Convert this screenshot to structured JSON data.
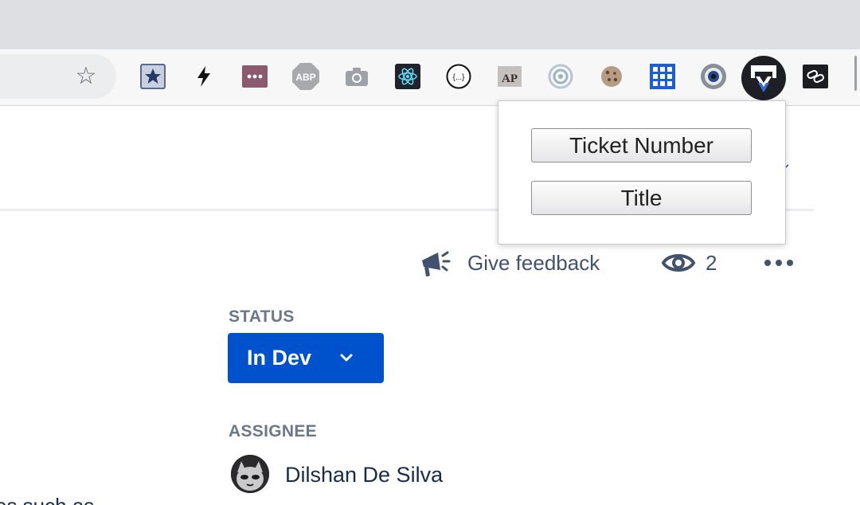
{
  "browser": {
    "extensions": [
      {
        "name": "star-bookmark-extension"
      },
      {
        "name": "lightning-extension"
      },
      {
        "name": "dots-extension"
      },
      {
        "name": "adblock-plus-extension",
        "text": "ABP"
      },
      {
        "name": "camera-extension"
      },
      {
        "name": "react-devtools-extension"
      },
      {
        "name": "json-formatter-extension",
        "text": "{...}"
      },
      {
        "name": "ap-extension",
        "text": "AP"
      },
      {
        "name": "target-extension"
      },
      {
        "name": "cookie-extension"
      },
      {
        "name": "grid-extension"
      },
      {
        "name": "eye-extension"
      },
      {
        "name": "ticket-copy-extension"
      },
      {
        "name": "link-extension"
      }
    ]
  },
  "popup": {
    "buttons": [
      "Ticket Number",
      "Title"
    ]
  },
  "page": {
    "feedback_label": "Give feedback",
    "watch_count": "2",
    "status": {
      "label": "STATUS",
      "value": "In Dev"
    },
    "assignee": {
      "label": "ASSIGNEE",
      "name": "Dilshan De Silva"
    },
    "cut_text": "es such as"
  },
  "colors": {
    "primary": "#0052cc",
    "muted": "#6b778c",
    "text": "#172b4d"
  }
}
